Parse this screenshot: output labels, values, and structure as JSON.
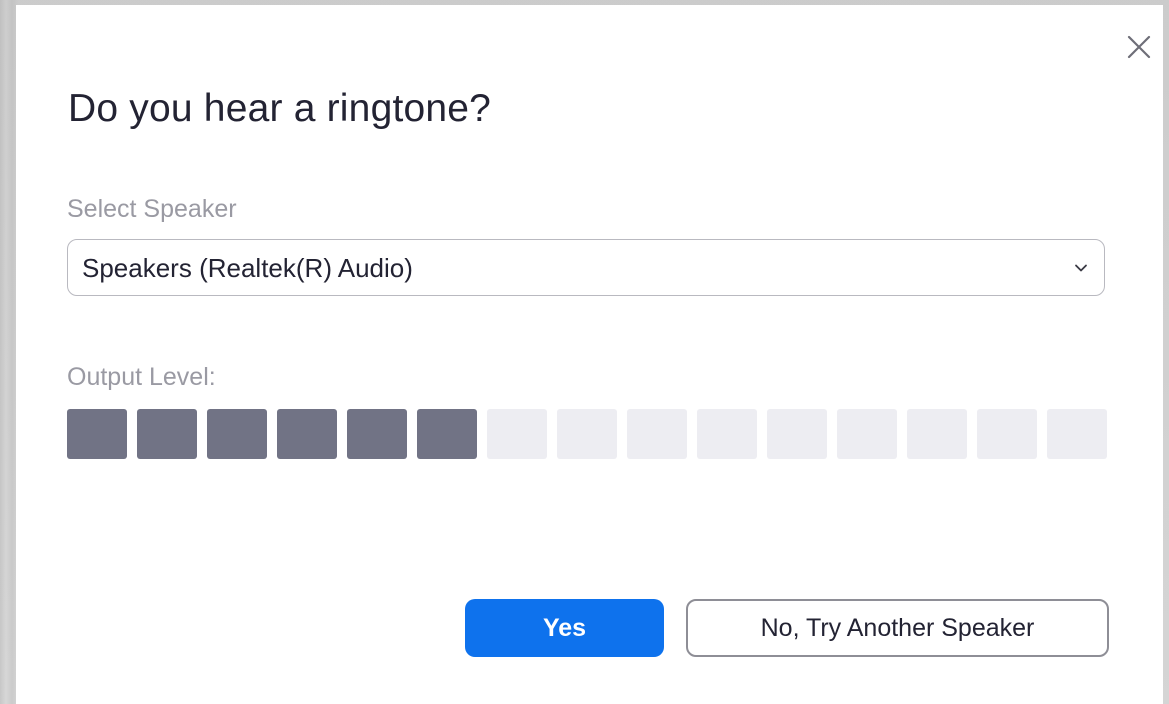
{
  "dialog": {
    "title": "Do you hear a ringtone?",
    "close_icon": "close-icon"
  },
  "speaker": {
    "label": "Select Speaker",
    "selected": "Speakers (Realtek(R) Audio)",
    "dropdown_icon": "chevron-down-icon"
  },
  "output_level": {
    "label": "Output Level:",
    "segments_total": 15,
    "segments_active": 6
  },
  "buttons": {
    "yes_label": "Yes",
    "no_label": "No, Try Another Speaker"
  },
  "colors": {
    "accent": "#0e72ed",
    "level_active": "#717385",
    "level_inactive": "#ededf2",
    "text_primary": "#232333",
    "text_secondary": "#9a9aa3"
  }
}
